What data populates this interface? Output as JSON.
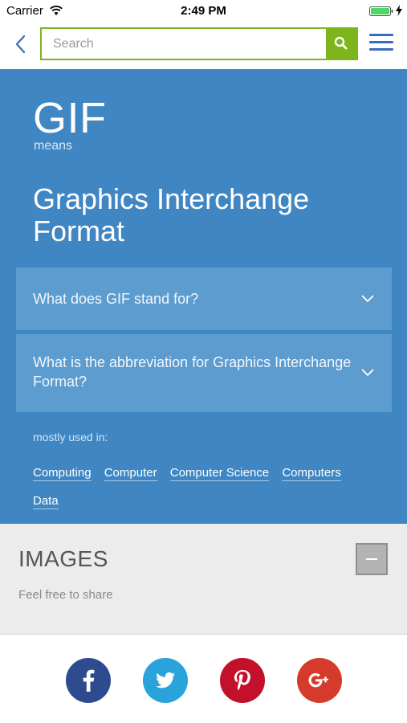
{
  "status_bar": {
    "carrier": "Carrier",
    "time": "2:49 PM"
  },
  "header": {
    "search_placeholder": "Search",
    "search_value": ""
  },
  "hero": {
    "acronym": "GIF",
    "means_label": "means",
    "expansion": "Graphics Interchange Format",
    "faq": [
      {
        "question": "What does GIF stand for?"
      },
      {
        "question": "What is the abbreviation for Graphics Interchange Format?"
      }
    ],
    "used_in_label": "mostly used in:",
    "tags": [
      "Computing",
      "Computer",
      "Computer Science",
      "Computers",
      "Data"
    ]
  },
  "images": {
    "title": "IMAGES",
    "subtitle": "Feel free to share"
  },
  "colors": {
    "hero_bg": "#3f86c2",
    "accent_green": "#7cb51c",
    "menu_blue": "#3b6cb7",
    "facebook": "#2d4b8e",
    "twitter": "#2aa3dc",
    "pinterest": "#c4112b",
    "google_plus": "#d63a2b"
  },
  "icons": {
    "back": "chevron-left-icon",
    "search": "search-icon",
    "menu": "hamburger-icon",
    "expand": "chevron-down-icon",
    "collapse": "minus-icon",
    "share": [
      "facebook-icon",
      "twitter-icon",
      "pinterest-icon",
      "google-plus-icon"
    ]
  }
}
